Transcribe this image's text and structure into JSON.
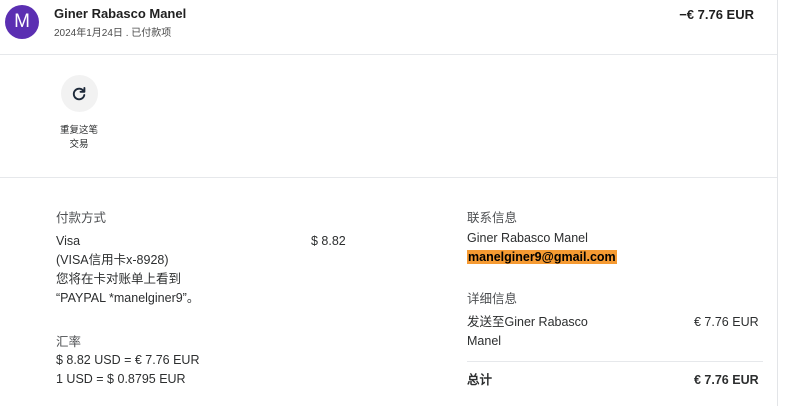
{
  "header": {
    "avatar_letter": "M",
    "name": "Giner Rabasco Manel",
    "subtitle": "2024年1月24日 . 已付款项",
    "amount": "−€ 7.76 EUR"
  },
  "repeat": {
    "icon": "refresh-icon",
    "label_line1": "重复这笔",
    "label_line2": "交易"
  },
  "payment": {
    "title": "付款方式",
    "method": "Visa",
    "amount": "$ 8.82",
    "card": "(VISA信用卡x-8928)",
    "statement_line1": "您将在卡对账单上看到",
    "statement_line2": "“PAYPAL *manelginer9”。"
  },
  "rate": {
    "title": "汇率",
    "line1": "$ 8.82 USD = € 7.76 EUR",
    "line2": "1 USD = $ 0.8795 EUR"
  },
  "contact": {
    "title": "联系信息",
    "name": "Giner Rabasco Manel",
    "email": "manelginer9@gmail.com"
  },
  "details": {
    "title": "详细信息",
    "sent_line1": "发送至Giner Rabasco",
    "sent_line2": "Manel",
    "sent_amount": "€ 7.76 EUR",
    "total_label": "总计",
    "total_amount": "€ 7.76 EUR"
  },
  "colors": {
    "avatar": "#5b2fb2",
    "email_highlight": "#f59a32"
  }
}
